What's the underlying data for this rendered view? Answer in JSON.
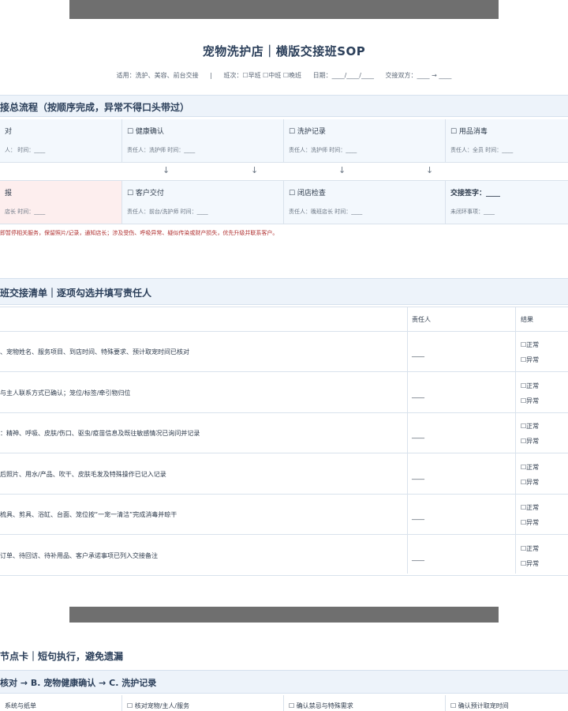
{
  "header": {
    "title": "宠物洗护店｜横版交接班SOP",
    "applies": "适用：洗护、美容、前台交接",
    "shift": "班次：☐早班 ☐中班 ☐晚班",
    "date": "日期：____/____/____",
    "parties": "交接双方：____ → ____"
  },
  "flow": {
    "title": "接总流程（按顺序完成，异常不得口头带过）",
    "row1": [
      {
        "label": "对",
        "sub": "人：    时间：____"
      },
      {
        "label": "☐ 健康确认",
        "sub": "责任人：洗护师    时间：____"
      },
      {
        "label": "☐ 洗护记录",
        "sub": "责任人：洗护师    时间：____"
      },
      {
        "label": "☐ 用品消毒",
        "sub": "责任人：全员    时间：____"
      }
    ],
    "row2": [
      {
        "label": "报",
        "sub": "店长    时间：____"
      },
      {
        "label": "☐ 客户交付",
        "sub": "责任人：前台/洗护师    时间：____"
      },
      {
        "label": "☐ 闭店检查",
        "sub": "责任人：晚班店长    时间：____"
      },
      {
        "label": "交接签字：____",
        "sub": "未闭环事项：____"
      }
    ],
    "arrow": "↓",
    "warning": "即暂停相关服务，保留照片/记录，通知店长；涉及受伤、呼吸异常、疑似传染或财产损失，优先升级并联系客户。"
  },
  "checklist": {
    "title": "班交接清单｜逐项勾选并填写责任人",
    "col_owner": "责任人",
    "col_result": "结果",
    "blank": "____",
    "ok": "☐正常",
    "bad": "☐异常",
    "rows": [
      "、宠物姓名、服务项目、到店时间、特殊要求、预计取宠时间已核对",
      "与主人联系方式已确认；笼位/标签/牵引物归位",
      "：精神、呼吸、皮肤/伤口、驱虫/疫苗信息及既往敏感情况已询问并记录",
      "后照片、用水/产品、吹干、皮肤毛发及特殊操作已记入记录",
      "梳具、剪具、浴缸、台面、笼位按“一宠一清洁”完成消毒并晾干",
      "订单、待回访、待补用品、客户承诺事项已列入交接备注"
    ]
  },
  "page2": {
    "title": "节点卡｜短句执行，避免遗漏",
    "flow": "核对 → B. 宠物健康确认 → C. 洗护记录",
    "row": [
      "系统与纸单",
      "☐ 核对宠物/主人/服务",
      "☐ 确认禁忌与特殊需求",
      "☐ 确认预计取宠时间"
    ]
  }
}
